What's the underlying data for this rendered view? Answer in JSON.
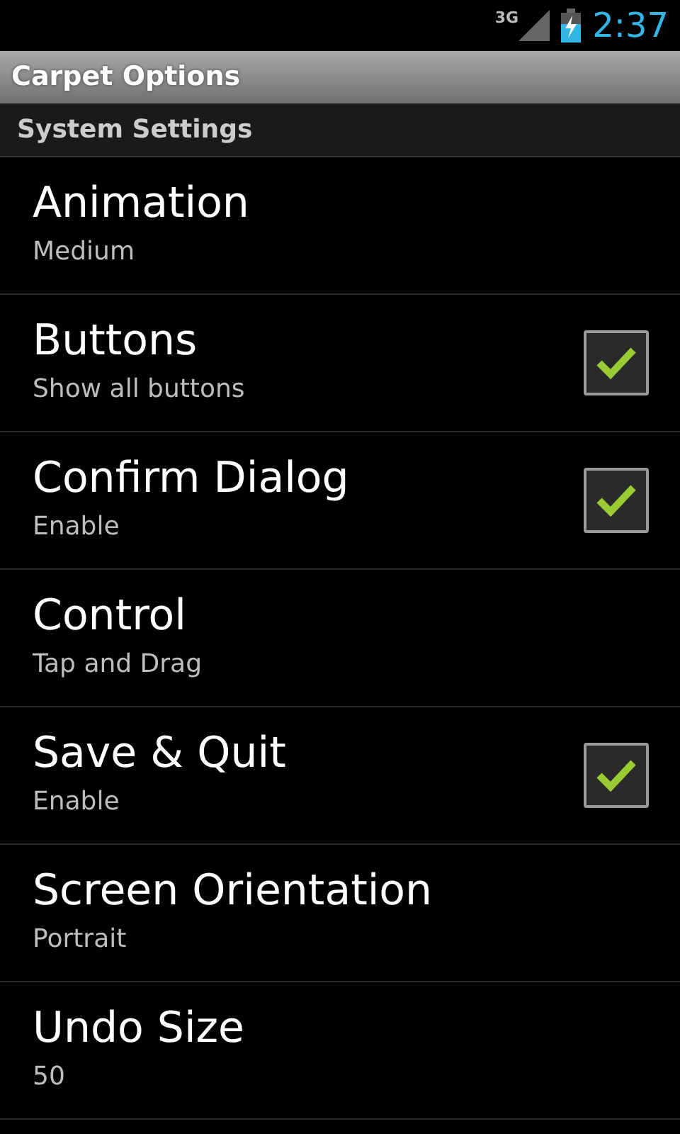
{
  "status_bar": {
    "network": "3G",
    "time": "2:37"
  },
  "window": {
    "title": "Carpet Options"
  },
  "section": {
    "title": "System Settings"
  },
  "settings": [
    {
      "kind": "plain",
      "title": "Animation",
      "summary": "Medium"
    },
    {
      "kind": "checkbox",
      "title": "Buttons",
      "summary": "Show all buttons",
      "checked": true
    },
    {
      "kind": "checkbox",
      "title": "Confirm Dialog",
      "summary": "Enable",
      "checked": true
    },
    {
      "kind": "plain",
      "title": "Control",
      "summary": "Tap and Drag"
    },
    {
      "kind": "checkbox",
      "title": "Save & Quit",
      "summary": "Enable",
      "checked": true
    },
    {
      "kind": "plain",
      "title": "Screen Orientation",
      "summary": "Portrait"
    },
    {
      "kind": "plain",
      "title": "Undo Size",
      "summary": "50"
    }
  ]
}
